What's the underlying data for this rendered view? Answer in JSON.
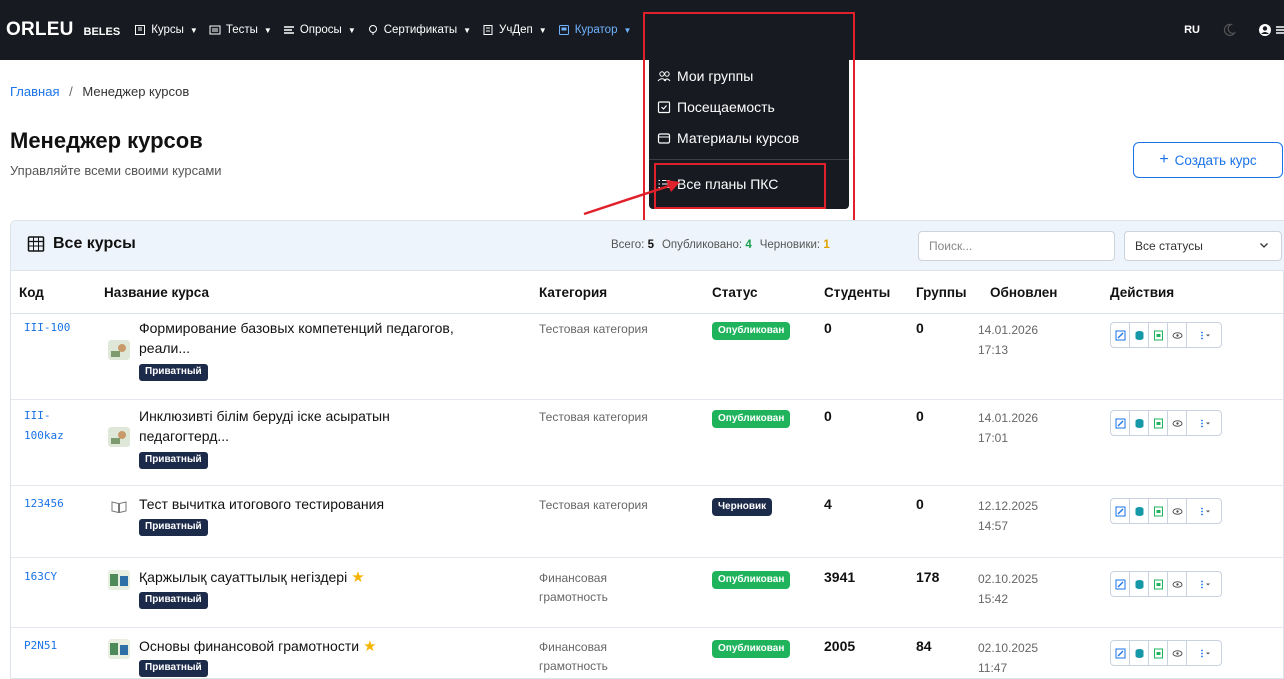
{
  "navbar": {
    "logo": "ORLEU",
    "brand_sub": "BELES",
    "items": [
      {
        "label": "Курсы",
        "icon": "book-icon"
      },
      {
        "label": "Тесты",
        "icon": "list-icon"
      },
      {
        "label": "Опросы",
        "icon": "poll-icon"
      },
      {
        "label": "Сертификаты",
        "icon": "certificate-icon"
      },
      {
        "label": "УчДеп",
        "icon": "building-icon"
      },
      {
        "label": "Куратор",
        "icon": "curator-icon"
      }
    ],
    "lang": "RU"
  },
  "curator_menu": {
    "items": [
      {
        "label": "Мои группы",
        "icon": "groups-icon"
      },
      {
        "label": "Посещаемость",
        "icon": "calendar-check-icon"
      },
      {
        "label": "Материалы курсов",
        "icon": "folder-icon"
      },
      {
        "label": "Все планы ПКС",
        "icon": "list-icon"
      }
    ]
  },
  "breadcrumb": {
    "home": "Главная",
    "separator": "/",
    "current": "Менеджер курсов"
  },
  "header": {
    "title": "Менеджер курсов",
    "subtitle": "Управляйте всеми своими курсами",
    "create_button": "Создать курс"
  },
  "table_card": {
    "title": "Все курсы",
    "stats": {
      "total_label": "Всего:",
      "total": "5",
      "published_label": "Опубликовано:",
      "published": "4",
      "drafts_label": "Черновики:",
      "drafts": "1"
    },
    "search_placeholder": "Поиск...",
    "status_filter": "Все статусы",
    "columns": [
      "Код",
      "Название курса",
      "Категория",
      "Статус",
      "Студенты",
      "Группы",
      "Обновлен",
      "Действия"
    ],
    "rows": [
      {
        "code": [
          "III-100"
        ],
        "name": [
          "Формирование базовых компетенций педагогов,",
          "реали..."
        ],
        "badge": "Приватный",
        "category": [
          "Тестовая категория"
        ],
        "status": "Опубликован",
        "students": "0",
        "groups": "0",
        "updated": [
          "14.01.2026",
          "17:13"
        ]
      },
      {
        "code": [
          "III-",
          "100kaz"
        ],
        "name": [
          "Инклюзивті білім беруді іске асыратын",
          "педагогтерд..."
        ],
        "badge": "Приватный",
        "category": [
          "Тестовая категория"
        ],
        "status": "Опубликован",
        "students": "0",
        "groups": "0",
        "updated": [
          "14.01.2026",
          "17:01"
        ]
      },
      {
        "code": [
          "123456"
        ],
        "name": [
          "Тест вычитка итогового тестирования"
        ],
        "badge": "Приватный",
        "category": [
          "Тестовая категория"
        ],
        "status": "Черновик",
        "students": "4",
        "groups": "0",
        "updated": [
          "12.12.2025",
          "14:57"
        ]
      },
      {
        "code": [
          "163CY"
        ],
        "name": [
          "Қаржылық сауаттылық негіздері"
        ],
        "badge": "Приватный",
        "category": [
          "Финансовая",
          "грамотность"
        ],
        "status": "Опубликован",
        "students": "3941",
        "groups": "178",
        "updated": [
          "02.10.2025",
          "15:42"
        ]
      },
      {
        "code": [
          "P2N51"
        ],
        "name": [
          "Основы финансовой грамотности"
        ],
        "badge": "Приватный",
        "category": [
          "Финансовая",
          "грамотность"
        ],
        "status": "Опубликован",
        "students": "2005",
        "groups": "84",
        "updated": [
          "02.10.2025",
          "11:47"
        ]
      }
    ]
  },
  "colors": {
    "navbar_bg": "#171a21",
    "link": "#1a73e8",
    "published": "#1fb35c",
    "draft": "#1d2b4a",
    "highlight": "#e0202a",
    "star": "#f4b400"
  }
}
